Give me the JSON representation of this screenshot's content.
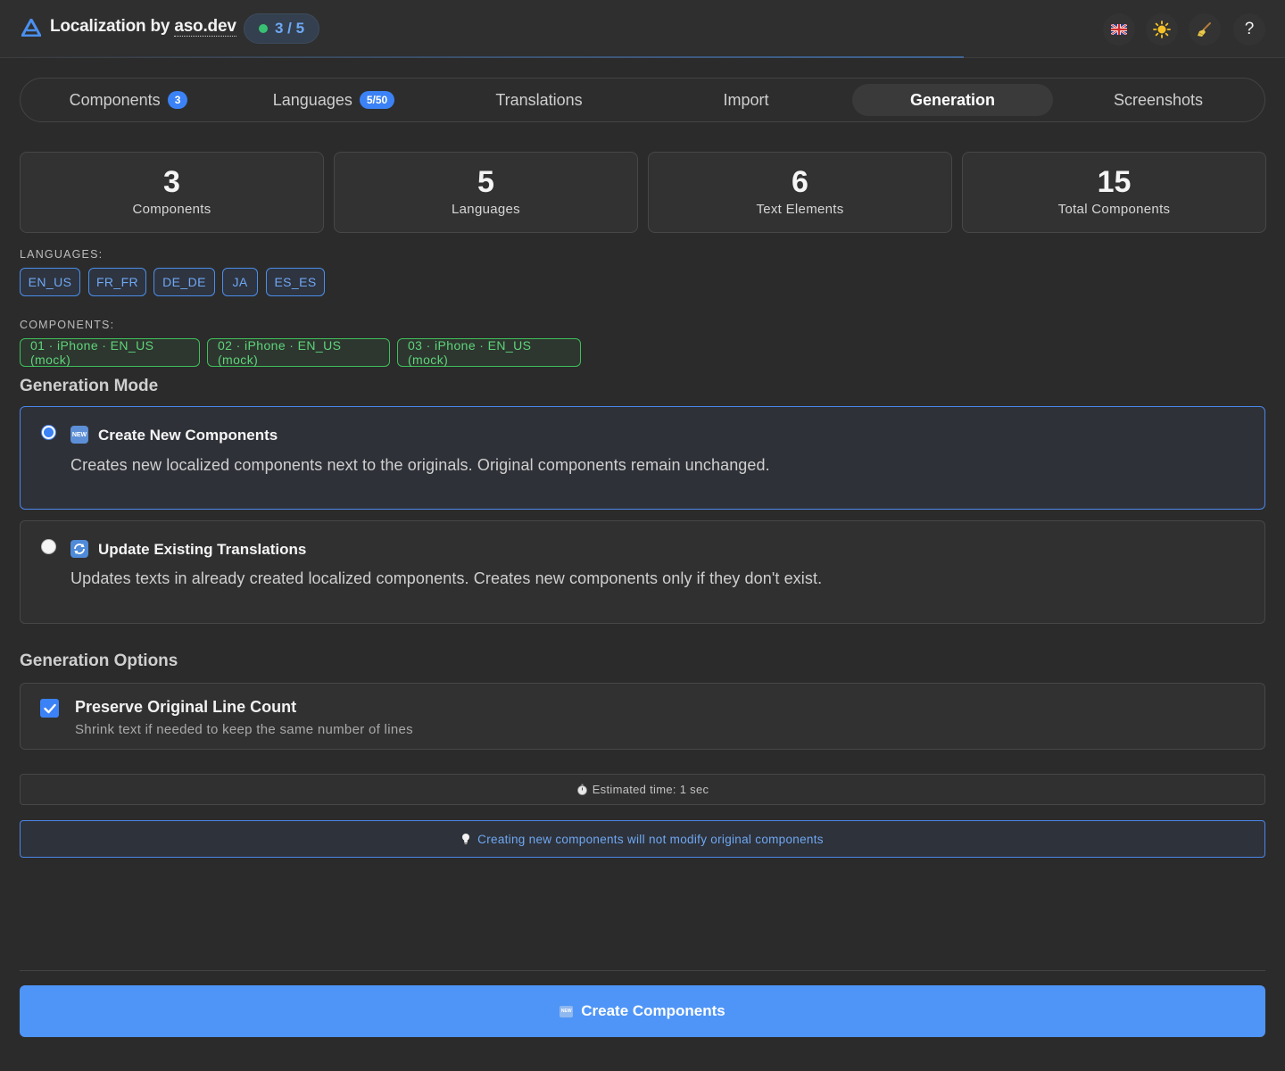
{
  "header": {
    "title_prefix": "Localization by ",
    "title_brand": "aso.dev",
    "progress": "3 / 5",
    "progress_status_color": "#38c172",
    "icons": [
      "flag-uk-icon",
      "sun-icon",
      "broom-icon",
      "help-icon"
    ],
    "help_label": "?"
  },
  "tabs": [
    {
      "label": "Components",
      "badge": "3"
    },
    {
      "label": "Languages",
      "badge": "5/50"
    },
    {
      "label": "Translations"
    },
    {
      "label": "Import"
    },
    {
      "label": "Generation",
      "active": true
    },
    {
      "label": "Screenshots"
    }
  ],
  "stats": [
    {
      "value": "3",
      "label": "Components"
    },
    {
      "value": "5",
      "label": "Languages"
    },
    {
      "value": "6",
      "label": "Text Elements"
    },
    {
      "value": "15",
      "label": "Total Components"
    }
  ],
  "languages": {
    "heading": "LANGUAGES:",
    "items": [
      "EN_US",
      "FR_FR",
      "DE_DE",
      "JA",
      "ES_ES"
    ]
  },
  "components": {
    "heading": "COMPONENTS:",
    "items": [
      "01 · iPhone · EN_US (mock)",
      "02 · iPhone · EN_US (mock)",
      "03 · iPhone · EN_US (mock)"
    ]
  },
  "generation_mode": {
    "title": "Generation Mode",
    "options": [
      {
        "icon_text": "NEW",
        "title": "Create New Components",
        "description": "Creates new localized components next to the originals. Original components remain unchanged.",
        "selected": true
      },
      {
        "icon_text": "",
        "title": "Update Existing Translations",
        "description": "Updates texts in already created localized components. Creates new components only if they don't exist.",
        "selected": false
      }
    ]
  },
  "generation_options": {
    "title": "Generation Options",
    "preserve_title": "Preserve Original Line Count",
    "preserve_desc": "Shrink text if needed to keep the same number of lines",
    "preserve_checked": true
  },
  "estimate": "Estimated time: 1 sec",
  "tip": "Creating new components will not modify original components",
  "create_button": {
    "label": "Create Components",
    "icon_text": "NEW"
  },
  "colors": {
    "accent": "#4f95f7",
    "language_chip": "#4b8ee8",
    "component_chip": "#3fbf5a"
  }
}
